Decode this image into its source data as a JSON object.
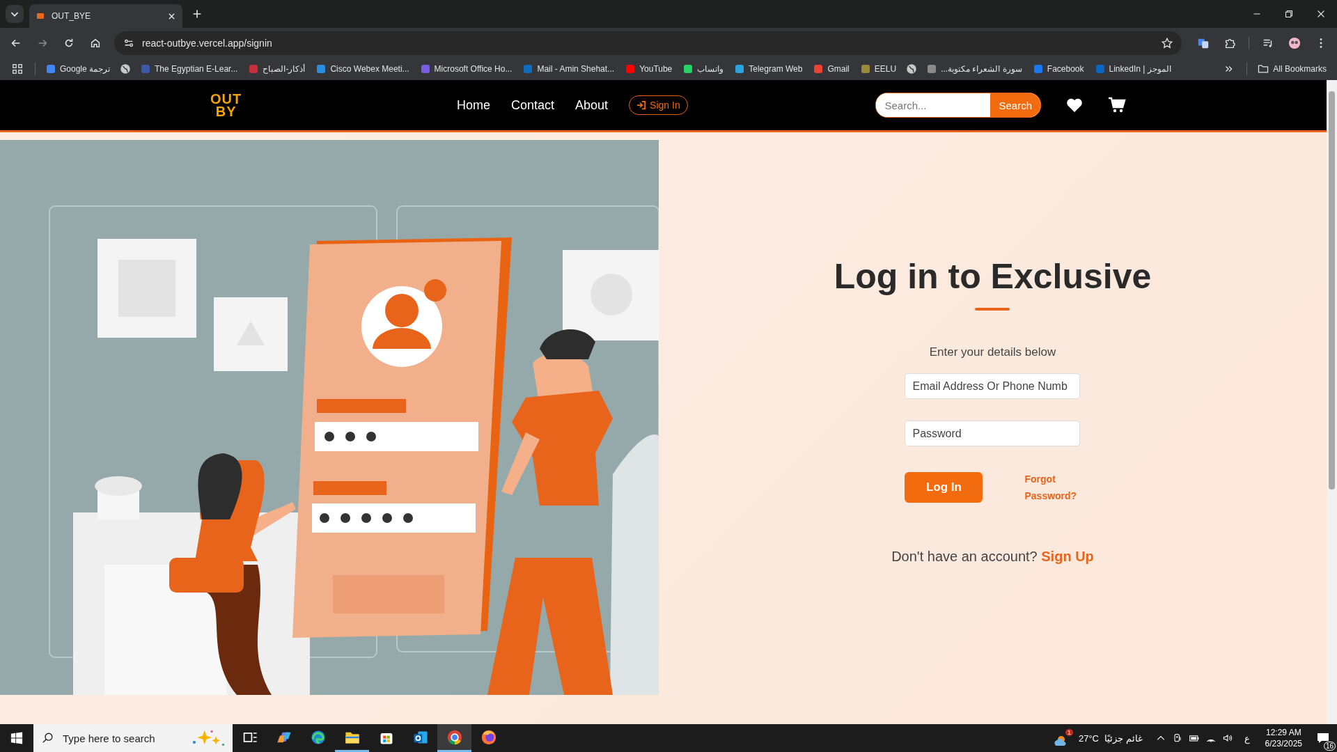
{
  "browser": {
    "tabs": [
      {
        "title": "OUT_BYE",
        "selected": true
      }
    ],
    "address": "react-outbye.vercel.app/signin",
    "bookmarks": [
      {
        "kind": "favicon",
        "label": "Google ترجمة",
        "color": "#4285f4"
      },
      {
        "kind": "globe"
      },
      {
        "kind": "favicon",
        "label": "The Egyptian E-Lear...",
        "color": "#3b5ba9"
      },
      {
        "kind": "favicon",
        "label": "أذكار-الصباح",
        "color": "#c62f3c"
      },
      {
        "kind": "favicon",
        "label": "Cisco Webex Meeti...",
        "color": "#2a8de0"
      },
      {
        "kind": "favicon",
        "label": "Microsoft Office Ho...",
        "color": "#7b5be0"
      },
      {
        "kind": "favicon",
        "label": "Mail - Amin Shehat...",
        "color": "#0f6cbd"
      },
      {
        "kind": "favicon",
        "label": "YouTube",
        "color": "#ff0000"
      },
      {
        "kind": "favicon",
        "label": "واتساب",
        "color": "#25d366"
      },
      {
        "kind": "favicon",
        "label": "Telegram Web",
        "color": "#2aa3de"
      },
      {
        "kind": "favicon",
        "label": "Gmail",
        "color": "#ea4335"
      },
      {
        "kind": "favicon",
        "label": "EELU",
        "color": "#9a8a3a"
      },
      {
        "kind": "globe"
      },
      {
        "kind": "favicon",
        "label": "سورة الشعراء مكتوبة...",
        "color": "#8a8a8a"
      },
      {
        "kind": "favicon",
        "label": "Facebook",
        "color": "#1877f2"
      },
      {
        "kind": "favicon",
        "label": "LinkedIn | الموجز",
        "color": "#0a66c2"
      }
    ],
    "all_bookmarks": "All Bookmarks"
  },
  "navbar": {
    "logo": [
      "OUT",
      "BY"
    ],
    "links": [
      {
        "label": "Home"
      },
      {
        "label": "Contact"
      },
      {
        "label": "About"
      }
    ],
    "sign_in": "Sign In",
    "search": {
      "placeholder": "Search...",
      "button": "Search"
    }
  },
  "login": {
    "title": "Log in to Exclusive",
    "subtitle": "Enter your details below",
    "fields": [
      {
        "placeholder": "Email Address Or Phone Numb"
      },
      {
        "placeholder": "Password"
      }
    ],
    "submit": "Log In",
    "forgot": "Forgot Password?",
    "signup_prompt": "Don't have an account?",
    "signup_link": "Sign Up"
  },
  "taskbar": {
    "search_placeholder": "Type here to search",
    "apps": [
      {
        "kind": "taskview",
        "running": false,
        "selected": false
      },
      {
        "kind": "copilot",
        "running": false,
        "selected": false
      },
      {
        "kind": "edge",
        "running": false,
        "selected": false
      },
      {
        "kind": "folder",
        "running": true,
        "selected": false
      },
      {
        "kind": "store",
        "running": false,
        "selected": false
      },
      {
        "kind": "outlook",
        "running": false,
        "selected": false
      },
      {
        "kind": "chrome",
        "running": true,
        "selected": true
      },
      {
        "kind": "firefox",
        "running": false,
        "selected": false
      }
    ],
    "weather": {
      "badge": "1",
      "temperature": "27°C",
      "condition": "غائم جزئيًا"
    },
    "language": "ع",
    "time": "12:29 AM",
    "date": "6/23/2025",
    "notifications": "16"
  }
}
